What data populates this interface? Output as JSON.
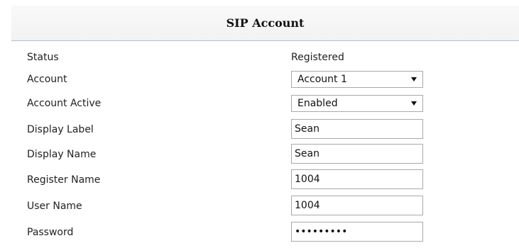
{
  "panel": {
    "title": "SIP Account"
  },
  "fields": {
    "status": {
      "label": "Status",
      "value": "Registered"
    },
    "account": {
      "label": "Account",
      "value": "Account 1"
    },
    "account_active": {
      "label": "Account Active",
      "value": "Enabled"
    },
    "display_label": {
      "label": "Display Label",
      "value": "Sean"
    },
    "display_name": {
      "label": "Display Name",
      "value": "Sean"
    },
    "register_name": {
      "label": "Register Name",
      "value": "1004"
    },
    "user_name": {
      "label": "User Name",
      "value": "1004"
    },
    "password": {
      "label": "Password",
      "value": "123456789"
    }
  },
  "icons": {
    "select_caret": "chevron-down-icon"
  },
  "colors": {
    "header_border": "#9fc3e3",
    "input_border": "#a9a9a9"
  }
}
